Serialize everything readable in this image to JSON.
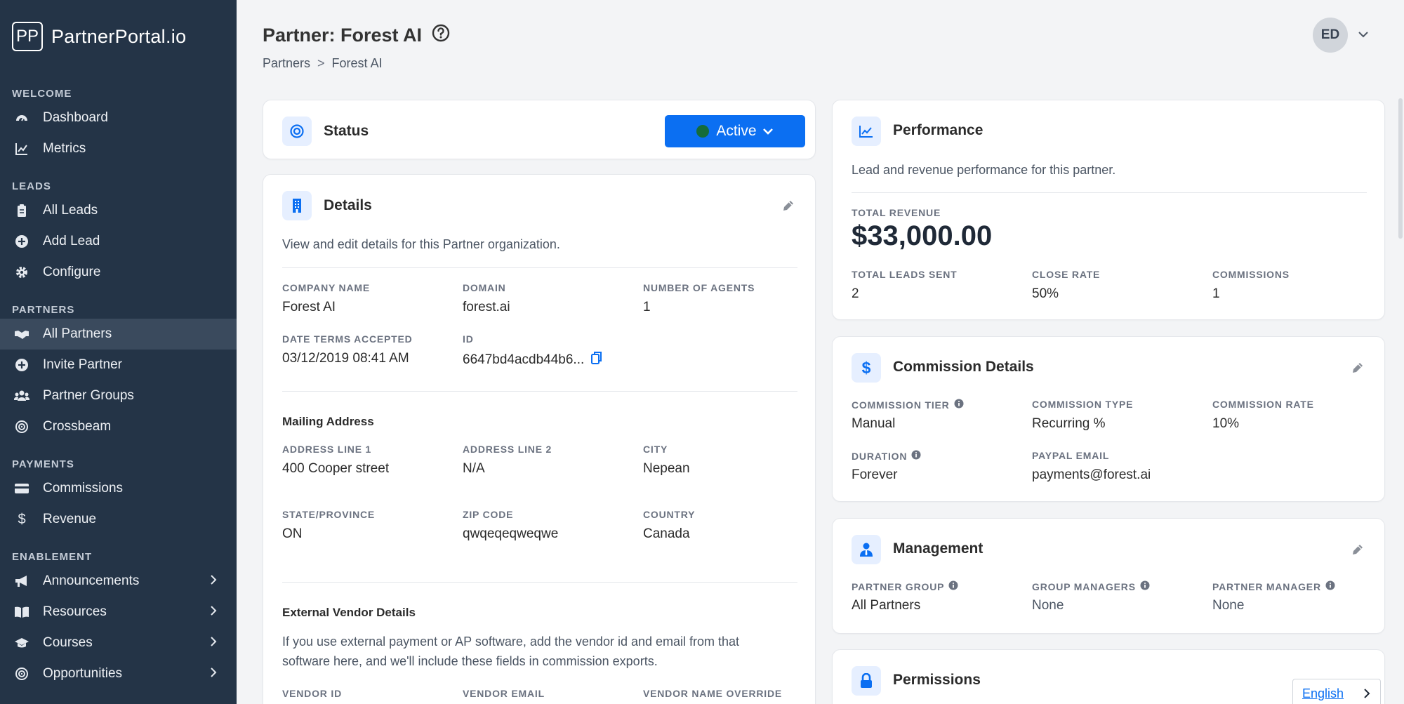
{
  "brand": {
    "logo": "PP",
    "name": "PartnerPortal.io"
  },
  "sidebar": {
    "sections": [
      {
        "title": "WELCOME",
        "items": [
          {
            "label": "Dashboard",
            "icon": "gauge-icon"
          },
          {
            "label": "Metrics",
            "icon": "chart-line-icon"
          }
        ]
      },
      {
        "title": "LEADS",
        "items": [
          {
            "label": "All Leads",
            "icon": "clipboard-icon"
          },
          {
            "label": "Add Lead",
            "icon": "plus-circle-icon"
          },
          {
            "label": "Configure",
            "icon": "gear-icon"
          }
        ]
      },
      {
        "title": "PARTNERS",
        "items": [
          {
            "label": "All Partners",
            "icon": "handshake-icon"
          },
          {
            "label": "Invite Partner",
            "icon": "plus-circle-icon"
          },
          {
            "label": "Partner Groups",
            "icon": "users-icon"
          },
          {
            "label": "Crossbeam",
            "icon": "target-icon"
          }
        ]
      },
      {
        "title": "PAYMENTS",
        "items": [
          {
            "label": "Commissions",
            "icon": "credit-card-icon"
          },
          {
            "label": "Revenue",
            "icon": "dollar-icon"
          }
        ]
      },
      {
        "title": "ENABLEMENT",
        "items": [
          {
            "label": "Announcements",
            "icon": "megaphone-icon"
          },
          {
            "label": "Resources",
            "icon": "book-icon"
          },
          {
            "label": "Courses",
            "icon": "graduation-cap-icon"
          },
          {
            "label": "Opportunities",
            "icon": "target-icon"
          }
        ]
      }
    ]
  },
  "header": {
    "title": "Partner: Forest AI",
    "breadcrumb": [
      "Partners",
      ">",
      "Forest AI"
    ],
    "user_initials": "ED"
  },
  "status": {
    "title": "Status",
    "value": "Active",
    "dot_color": "#156c3a",
    "button_color": "#0b6ff2"
  },
  "details": {
    "title": "Details",
    "description": "View and edit details for this Partner organization.",
    "company_name": {
      "label": "COMPANY NAME",
      "value": "Forest AI"
    },
    "domain": {
      "label": "DOMAIN",
      "value": "forest.ai"
    },
    "agents": {
      "label": "NUMBER OF AGENTS",
      "value": "1"
    },
    "terms": {
      "label": "DATE TERMS ACCEPTED",
      "value": "03/12/2019 08:41 AM"
    },
    "id": {
      "label": "ID",
      "value": "6647bd4acdb44b6..."
    },
    "mailing": {
      "title": "Mailing Address",
      "line1": {
        "label": "ADDRESS LINE 1",
        "value": "400 Cooper street"
      },
      "line2": {
        "label": "ADDRESS LINE 2",
        "value": "N/A"
      },
      "city": {
        "label": "CITY",
        "value": "Nepean"
      },
      "state": {
        "label": "STATE/PROVINCE",
        "value": "ON"
      },
      "zip": {
        "label": "ZIP CODE",
        "value": "qwqeqeqweqwe"
      },
      "country": {
        "label": "COUNTRY",
        "value": "Canada"
      }
    },
    "vendor": {
      "title": "External Vendor Details",
      "description_1": "If you use external payment or AP software, add the vendor id and email from that",
      "description_2": "software here, and we'll include these fields in commission exports.",
      "id_label": "VENDOR ID",
      "email_label": "VENDOR EMAIL",
      "name_label": "VENDOR NAME OVERRIDE"
    }
  },
  "performance": {
    "title": "Performance",
    "description": "Lead and revenue performance for this partner.",
    "revenue": {
      "label": "TOTAL REVENUE",
      "value": "$33,000.00"
    },
    "leads": {
      "label": "TOTAL LEADS SENT",
      "value": "2"
    },
    "close_rate": {
      "label": "CLOSE RATE",
      "value": "50%"
    },
    "commissions": {
      "label": "COMMISSIONS",
      "value": "1"
    }
  },
  "commission": {
    "title": "Commission Details",
    "tier": {
      "label": "COMMISSION TIER",
      "value": "Manual"
    },
    "type": {
      "label": "COMMISSION TYPE",
      "value": "Recurring %"
    },
    "rate": {
      "label": "COMMISSION RATE",
      "value": "10%"
    },
    "duration": {
      "label": "DURATION",
      "value": "Forever"
    },
    "paypal": {
      "label": "PAYPAL EMAIL",
      "value": "payments@forest.ai"
    }
  },
  "management": {
    "title": "Management",
    "group": {
      "label": "PARTNER GROUP",
      "value": "All Partners"
    },
    "managers": {
      "label": "GROUP MANAGERS",
      "value": "None"
    },
    "partner_manager": {
      "label": "PARTNER MANAGER",
      "value": "None"
    }
  },
  "permissions": {
    "title": "Permissions"
  },
  "language": {
    "label": "English"
  }
}
